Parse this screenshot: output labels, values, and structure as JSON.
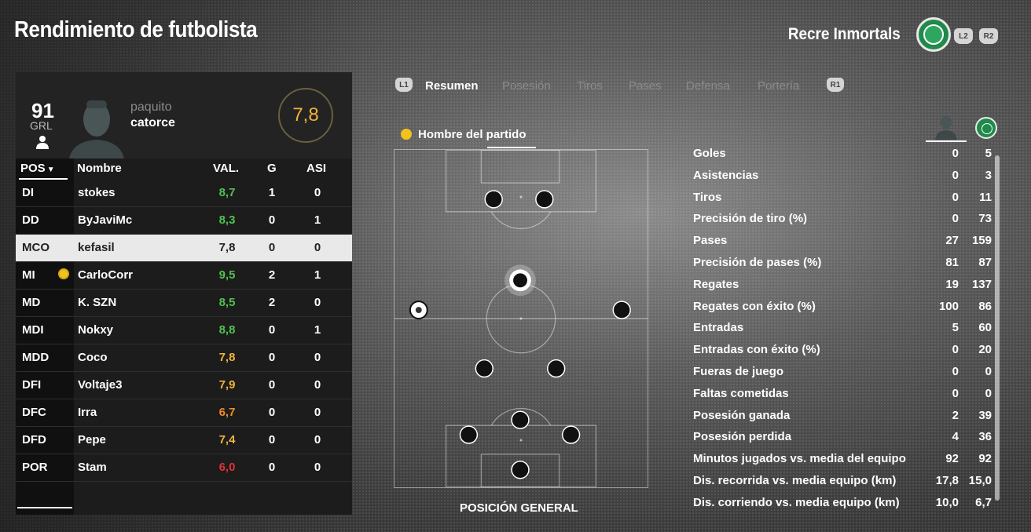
{
  "header": {
    "title": "Rendimiento de futbolista",
    "club_name": "Recre Inmortals",
    "l2": "L2",
    "r2": "R2"
  },
  "player_card": {
    "overall": "91",
    "overall_label": "GRL",
    "first_name": "paquito",
    "last_name": "catorce",
    "rating": "7,8"
  },
  "table": {
    "headers": {
      "pos": "POS",
      "name": "Nombre",
      "val": "VAL.",
      "g": "G",
      "asi": "ASI"
    },
    "rows": [
      {
        "pos": "DI",
        "name": "stokes",
        "val": "8,7",
        "g": "1",
        "asi": "0",
        "val_color": "#4fc24f"
      },
      {
        "pos": "DD",
        "name": "ByJaviMc",
        "val": "8,3",
        "g": "0",
        "asi": "1",
        "val_color": "#4fc24f"
      },
      {
        "pos": "MCO",
        "name": "kefasil",
        "val": "7,8",
        "g": "0",
        "asi": "0",
        "val_color": "#222222",
        "selected": true
      },
      {
        "pos": "MI",
        "name": "CarloCorr",
        "val": "9,5",
        "g": "2",
        "asi": "1",
        "val_color": "#4fc24f",
        "motm": true
      },
      {
        "pos": "MD",
        "name": "K. SZN",
        "val": "8,5",
        "g": "2",
        "asi": "0",
        "val_color": "#4fc24f"
      },
      {
        "pos": "MDI",
        "name": "Nokxy",
        "val": "8,8",
        "g": "0",
        "asi": "1",
        "val_color": "#4fc24f"
      },
      {
        "pos": "MDD",
        "name": "Coco",
        "val": "7,8",
        "g": "0",
        "asi": "0",
        "val_color": "#f0b33a"
      },
      {
        "pos": "DFI",
        "name": "Voltaje3",
        "val": "7,9",
        "g": "0",
        "asi": "0",
        "val_color": "#f0b33a"
      },
      {
        "pos": "DFC",
        "name": "Irra",
        "val": "6,7",
        "g": "0",
        "asi": "0",
        "val_color": "#f08a2a"
      },
      {
        "pos": "DFD",
        "name": "Pepe",
        "val": "7,4",
        "g": "0",
        "asi": "0",
        "val_color": "#f0b33a"
      },
      {
        "pos": "POR",
        "name": "Stam",
        "val": "6,0",
        "g": "0",
        "asi": "0",
        "val_color": "#e03030"
      }
    ]
  },
  "tabs": {
    "l1": "L1",
    "r1": "R1",
    "items": [
      "Resumen",
      "Posesión",
      "Tiros",
      "Pases",
      "Defensa",
      "Portería"
    ],
    "active": "Resumen"
  },
  "pitch": {
    "motm_label": "Hombre del partido",
    "title": "POSICIÓN GENERAL"
  },
  "stats": [
    {
      "label": "Goles",
      "player": "0",
      "team": "5"
    },
    {
      "label": "Asistencias",
      "player": "0",
      "team": "3"
    },
    {
      "label": "Tiros",
      "player": "0",
      "team": "11"
    },
    {
      "label": "Precisión de tiro (%)",
      "player": "0",
      "team": "73"
    },
    {
      "label": "Pases",
      "player": "27",
      "team": "159"
    },
    {
      "label": "Precisión de pases (%)",
      "player": "81",
      "team": "87"
    },
    {
      "label": "Regates",
      "player": "19",
      "team": "137"
    },
    {
      "label": "Regates con éxito (%)",
      "player": "100",
      "team": "86"
    },
    {
      "label": "Entradas",
      "player": "5",
      "team": "60"
    },
    {
      "label": "Entradas con éxito (%)",
      "player": "0",
      "team": "20"
    },
    {
      "label": "Fueras de juego",
      "player": "0",
      "team": "0"
    },
    {
      "label": "Faltas cometidas",
      "player": "0",
      "team": "0"
    },
    {
      "label": "Posesión ganada",
      "player": "2",
      "team": "39"
    },
    {
      "label": "Posesión perdida",
      "player": "4",
      "team": "36"
    },
    {
      "label": "Minutos jugados vs. media del equipo",
      "player": "92",
      "team": "92"
    },
    {
      "label": "Dis. recorrida vs. media equipo (km)",
      "player": "17,8",
      "team": "15,0"
    },
    {
      "label": "Dis. corriendo vs. media equipo (km)",
      "player": "10,0",
      "team": "6,7"
    }
  ],
  "colors": {
    "accent_gold": "#f0b33a",
    "motm_yellow": "#f2c21d",
    "club_green": "#1f8a4a"
  }
}
